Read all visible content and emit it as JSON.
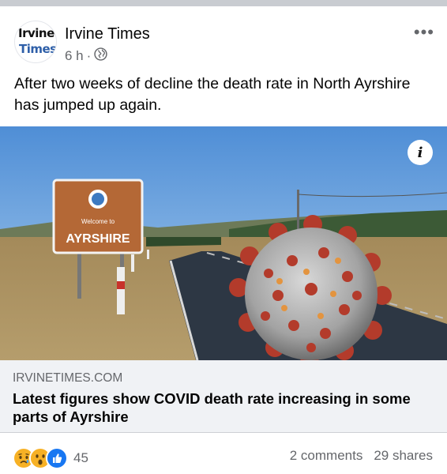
{
  "post": {
    "page_name": "Irvine Times",
    "logo_line1": "Irvine",
    "logo_line2": "Times",
    "time": "6 h",
    "separator": "·",
    "audience_icon": "globe-icon",
    "text": "After two weeks of decline the death rate in North Ayrshire has jumped up again."
  },
  "image": {
    "sign_line1": "Welcome to",
    "sign_line2": "AYRSHIRE",
    "info_label": "i"
  },
  "link": {
    "domain": "IRVINETIMES.COM",
    "headline": "Latest figures show COVID death rate increasing in some parts of Ayrshire"
  },
  "footer": {
    "reaction_icons": [
      "sad-icon",
      "wow-icon",
      "like-icon"
    ],
    "reaction_count": "45",
    "comments": "2 comments",
    "shares": "29 shares"
  },
  "colors": {
    "brand_blue": "#1877f2",
    "muted": "#65676b",
    "preview_bg": "#f0f2f5"
  }
}
